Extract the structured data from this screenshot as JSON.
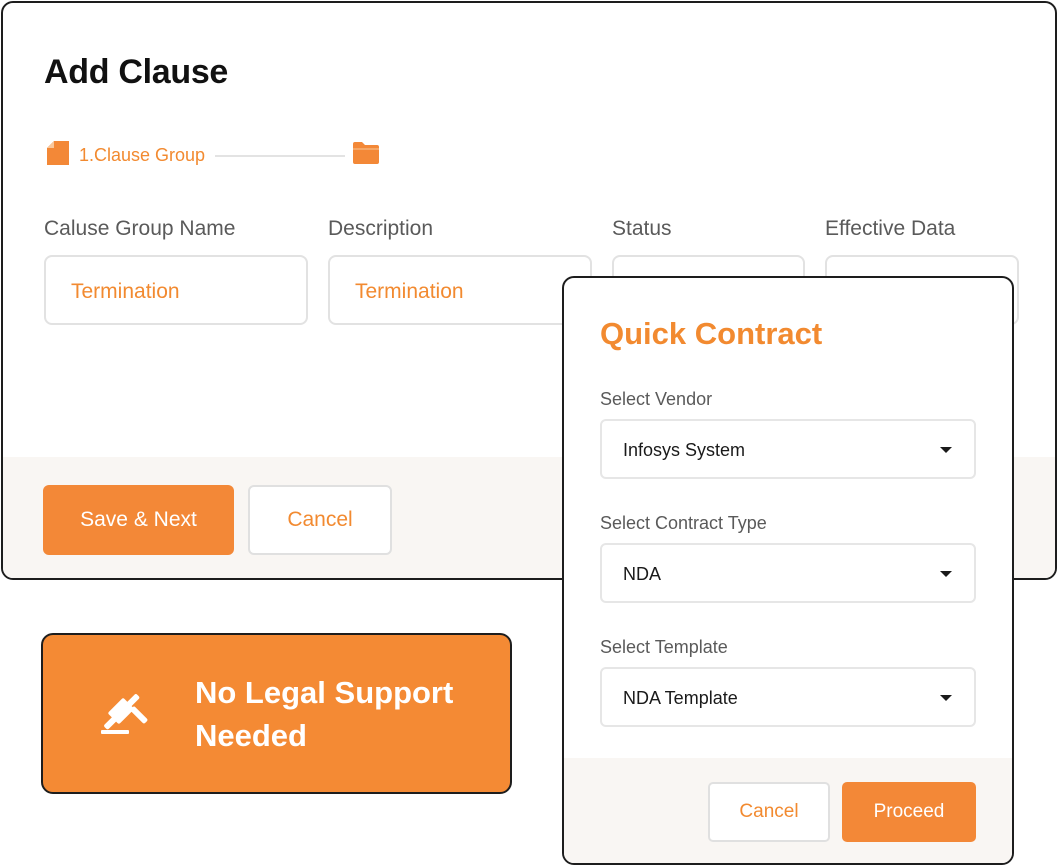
{
  "clause_form": {
    "title": "Add Clause",
    "stepper": {
      "step1_label": "1.Clause Group"
    },
    "fields": [
      {
        "label": "Caluse Group Name",
        "value": "Termination"
      },
      {
        "label": "Description",
        "value": "Termination"
      },
      {
        "label": "Status",
        "value": ""
      },
      {
        "label": "Effective Data",
        "value": ""
      }
    ],
    "save_label": "Save & Next",
    "cancel_label": "Cancel"
  },
  "legal_banner": {
    "icon": "gavel-icon",
    "line1": "No Legal Support",
    "line2": "Needed"
  },
  "quick_contract": {
    "title": "Quick Contract",
    "vendor": {
      "label": "Select Vendor",
      "value": "Infosys System"
    },
    "contract_type": {
      "label": "Select Contract Type",
      "value": "NDA"
    },
    "template": {
      "label": "Select Template",
      "value": "NDA Template"
    },
    "cancel_label": "Cancel",
    "proceed_label": "Proceed"
  },
  "colors": {
    "accent": "#f38837",
    "footer_bg": "#f9f6f3",
    "border_dark": "#1d1d1d"
  }
}
